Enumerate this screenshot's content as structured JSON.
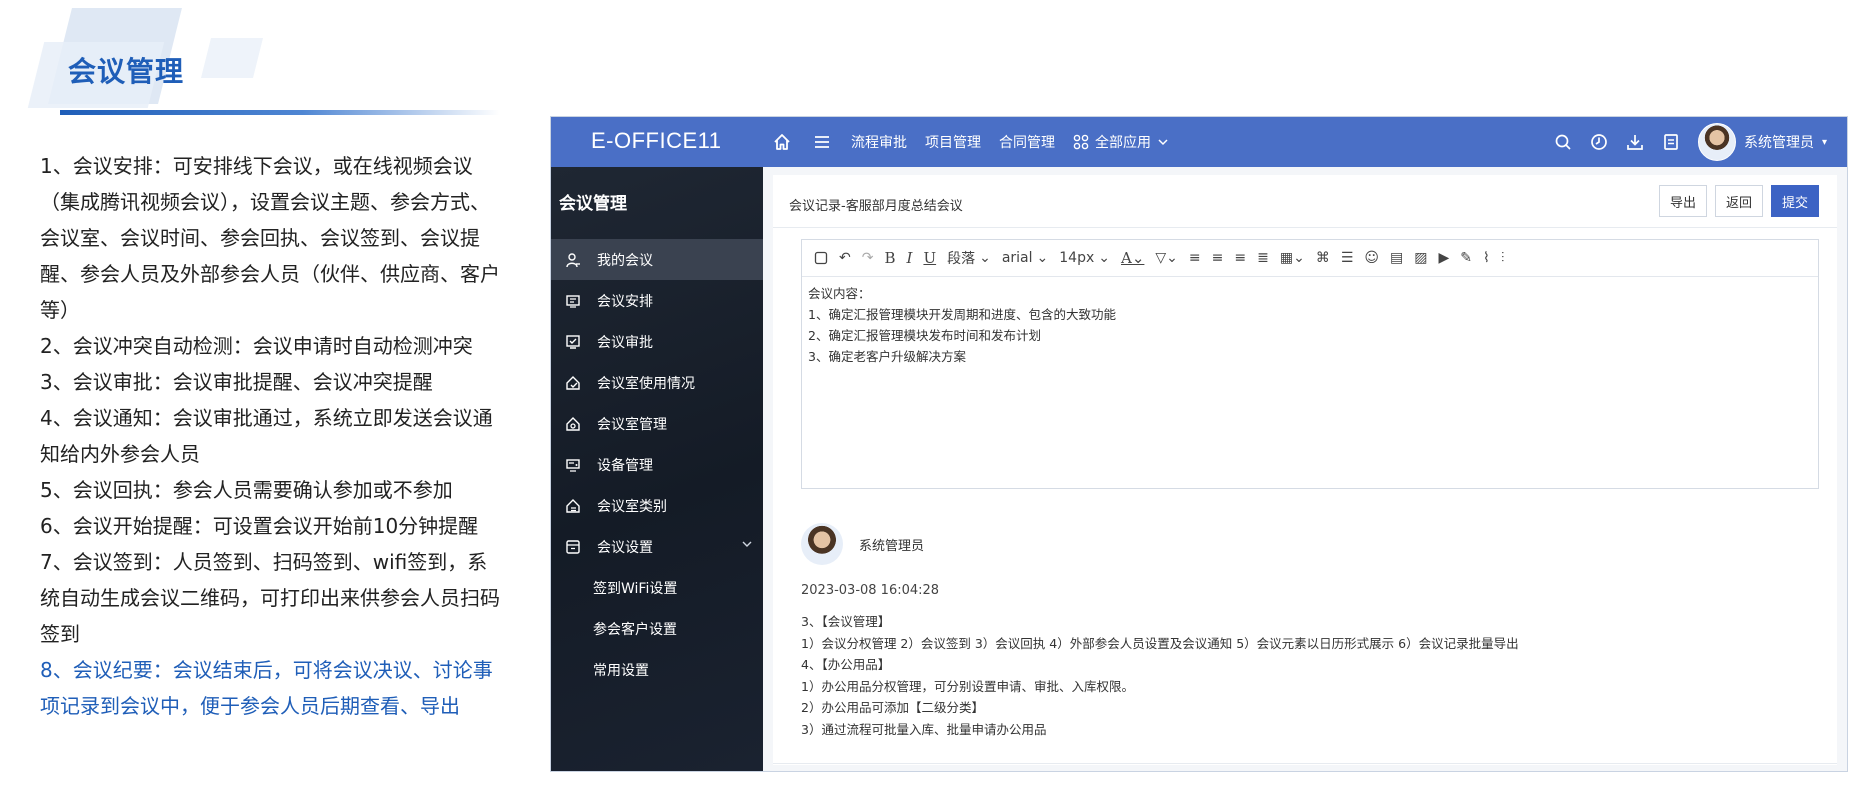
{
  "slide": {
    "title": "会议管理",
    "features": [
      "1、会议安排：可安排线下会议，或在线视频会议（集成腾讯视频会议），设置会议主题、参会方式、会议室、会议时间、参会回执、会议签到、会议提醒、参会人员及外部参会人员（伙伴、供应商、客户等）",
      "2、会议冲突自动检测：会议申请时自动检测冲突",
      "3、会议审批：会议审批提醒、会议冲突提醒",
      "4、会议通知：会议审批通过，系统立即发送会议通知给内外参会人员",
      "5、会议回执：参会人员需要确认参加或不参加",
      "6、会议开始提醒：可设置会议开始前10分钟提醒",
      "7、会议签到：人员签到、扫码签到、wifi签到，系统自动生成会议二维码，可打印出来供参会人员扫码签到"
    ],
    "highlight": "8、会议纪要：会议结束后，可将会议决议、讨论事项记录到会议中，便于参会人员后期查看、导出",
    "highlight_color": "#1f5eb8"
  },
  "app": {
    "logo": "E-OFFICE11",
    "nav": [
      "流程审批",
      "项目管理",
      "合同管理"
    ],
    "all_apps": "全部应用",
    "user_name": "系统管理员",
    "brand_color": "#4a6fc6",
    "sidebar": {
      "title": "会议管理",
      "items": [
        {
          "label": "我的会议",
          "icon": "user-icon"
        },
        {
          "label": "会议安排",
          "icon": "calendar-icon"
        },
        {
          "label": "会议审批",
          "icon": "approve-icon"
        },
        {
          "label": "会议室使用情况",
          "icon": "room-usage-icon"
        },
        {
          "label": "会议室管理",
          "icon": "room-manage-icon"
        },
        {
          "label": "设备管理",
          "icon": "device-icon"
        },
        {
          "label": "会议室类别",
          "icon": "room-category-icon"
        },
        {
          "label": "会议设置",
          "icon": "settings-box-icon"
        }
      ],
      "sub_items": [
        "签到WiFi设置",
        "参会客户设置",
        "常用设置"
      ]
    },
    "record": {
      "breadcrumb": "会议记录-客服部月度总结会议",
      "buttons": {
        "export": "导出",
        "back": "返回",
        "submit": "提交"
      },
      "toolbar": {
        "paragraph": "段落",
        "font": "arial",
        "size": "14px"
      },
      "editor_lines": [
        "会议内容：",
        "1、确定汇报管理模块开发周期和进度、包含的大致功能",
        "2、确定汇报管理模块发布时间和发布计划",
        "3、确定老客户升级解决方案"
      ],
      "author": "系统管理员",
      "time": "2023-03-08 16:04:28",
      "log_lines": [
        "3、【会议管理】",
        "1）会议分权管理 2）会议签到 3）会议回执 4）外部参会人员设置及会议通知 5）会议元素以日历形式展示 6）会议记录批量导出",
        "4、【办公用品】",
        "1）办公用品分权管理，可分别设置申请、审批、入库权限。",
        "2）办公用品可添加【二级分类】",
        "3）通过流程可批量入库、批量申请办公用品"
      ]
    }
  }
}
